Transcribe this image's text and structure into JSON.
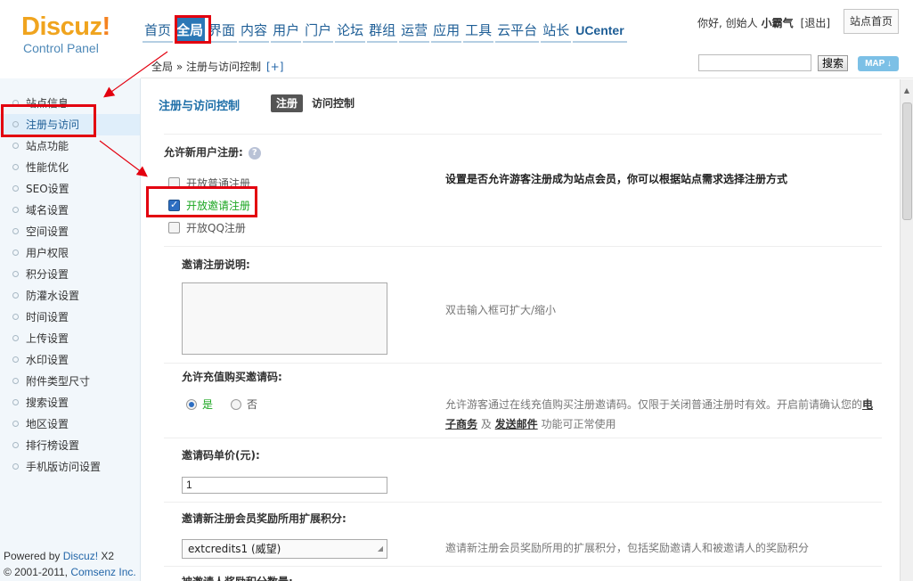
{
  "logo": {
    "main": "Discuz",
    "bang": "!",
    "sub": "Control Panel"
  },
  "topnav": [
    "首页",
    "全局",
    "界面",
    "内容",
    "用户",
    "门户",
    "论坛",
    "群组",
    "运营",
    "应用",
    "工具",
    "云平台",
    "站长",
    "UCenter"
  ],
  "user": {
    "greeting": "你好, 创始人",
    "name": "小霸气",
    "logout": "[退出]",
    "site_home": "站点首页"
  },
  "crumb": {
    "text": "全局 » 注册与访问控制",
    "plus": "[+]"
  },
  "search": {
    "button": "搜索",
    "map": "MAP ↓"
  },
  "sidebar": {
    "items": [
      "站点信息",
      "注册与访问",
      "站点功能",
      "性能优化",
      "SEO设置",
      "域名设置",
      "空间设置",
      "用户权限",
      "积分设置",
      "防灌水设置",
      "时间设置",
      "上传设置",
      "水印设置",
      "附件类型尺寸",
      "搜索设置",
      "地区设置",
      "排行榜设置",
      "手机版访问设置"
    ],
    "powered_prefix": "Powered by ",
    "powered_brand": "Discuz!",
    "powered_version": " X2",
    "copy_prefix": "© 2001-2011, ",
    "copy_brand": "Comsenz Inc."
  },
  "main": {
    "title": "注册与访问控制",
    "tabs": [
      "注册",
      "访问控制"
    ],
    "allow_reg_label": "允许新用户注册:",
    "help_icon": "?",
    "options": [
      "开放普通注册",
      "开放邀请注册",
      "开放QQ注册"
    ],
    "allow_reg_desc": "设置是否允许游客注册成为站点会员，你可以根据站点需求选择注册方式",
    "invite_desc_label": "邀请注册说明:",
    "textarea_hint": "双击输入框可扩大/缩小",
    "buy_code_label": "允许充值购买邀请码:",
    "radio_yes": "是",
    "radio_no": "否",
    "buy_code_desc_1": "允许游客通过在线充值购买注册邀请码。仅限于关闭普通注册时有效。开启前请确认您的",
    "buy_code_link_1a": "电",
    "buy_code_link_1b": "子商务",
    "buy_code_desc_and": " 及 ",
    "buy_code_link_2": "发送邮件",
    "buy_code_desc_2": " 功能可正常使用",
    "price_label": "邀请码单价(元):",
    "price_value": "1",
    "credit_label": "邀请新注册会员奖励所用扩展积分:",
    "credit_value": "extcredits1 (威望)",
    "credit_desc": "邀请新注册会员奖励所用的扩展积分，包括奖励邀请人和被邀请人的奖励积分",
    "next_label": "被邀请人奖励积分数量:"
  }
}
